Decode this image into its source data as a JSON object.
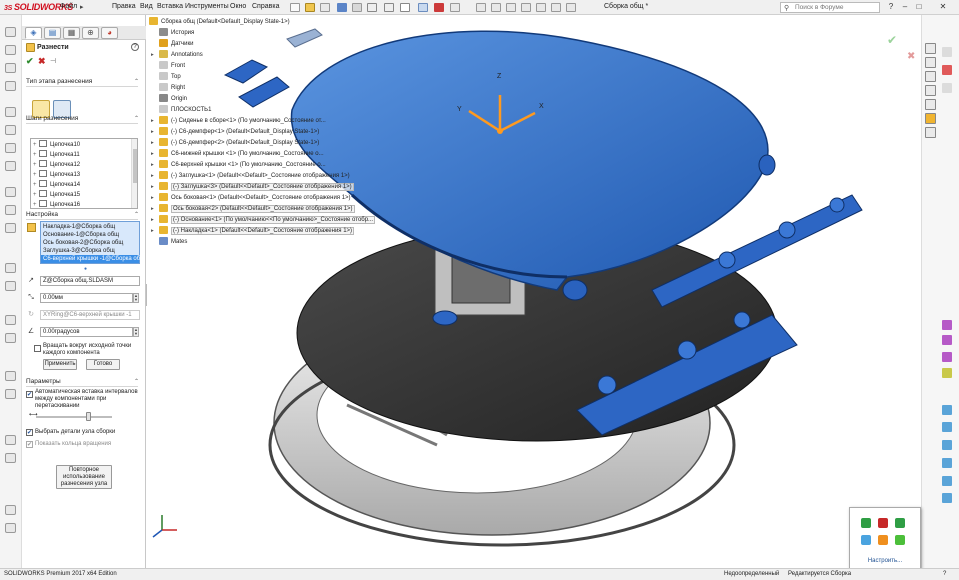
{
  "app": {
    "logo_prefix": "3S",
    "logo": "SOLIDWORKS",
    "document_title": "Сборка общ *"
  },
  "menu": [
    "Файл",
    "Правка",
    "Вид",
    "Вставка",
    "Инструменты",
    "Окно",
    "Справка"
  ],
  "search": {
    "placeholder": "Поиск в Форуме"
  },
  "property_manager": {
    "title": "Разнести",
    "help": "?",
    "ok": "✔",
    "cancel": "✖",
    "pin": "⊣",
    "section_type": "Тип этапа разнесения",
    "section_steps": "Шаги разнесения",
    "steps": [
      {
        "expand": "+",
        "label": "Цепочка10"
      },
      {
        "expand": "+",
        "label": "Цепочка11"
      },
      {
        "expand": "+",
        "label": "Цепочка12"
      },
      {
        "expand": "+",
        "label": "Цепочка13"
      },
      {
        "expand": "+",
        "label": "Цепочка14"
      },
      {
        "expand": "+",
        "label": "Цепочка15"
      },
      {
        "expand": "+",
        "label": "Цепочка16"
      }
    ],
    "section_settings": "Настройка",
    "components": [
      "Накладка-1@Сборка общ",
      "Основание-1@Сборка общ",
      "Ось боковая-2@Сборка общ",
      "Заглушка-3@Сборка общ",
      "С6-верхней крышки -1@Сборка об"
    ],
    "direction_field": "Z@Сборка общ.SLDASM",
    "distance_value": "0.00мм",
    "rotation_axis_placeholder": "XYRing@С6-верхней крышки -1",
    "angle_value": "0.00градусов",
    "rotate_about_origin_label": "Вращать вокруг исходной точки каждого компонента",
    "apply_button": "Применить",
    "done_button": "Готово",
    "section_params": "Параметры",
    "auto_space_label": "Автоматическая вставка интервалов между компонентами при перетаскивании",
    "select_subassembly_label": "Выбрать детали узла сборки",
    "show_rotation_rings_label": "Показать кольца вращения",
    "reuse_button": "Повторное использование разнесения узла",
    "auto_space_checked": true,
    "select_subassembly_checked": true,
    "show_rings_checked": true,
    "rotate_origin_checked": false,
    "spacing_slider_fraction": 0.68
  },
  "tree": {
    "root": "Сборка общ  (Default<Default_Display State-1>)",
    "rows": [
      {
        "expand": "",
        "icon": "history-icon",
        "label": "История",
        "color": "#8c8c8c",
        "boxed": false
      },
      {
        "expand": "",
        "icon": "sensor-icon",
        "label": "Датчики",
        "color": "#e0a01c",
        "boxed": false
      },
      {
        "expand": "▸",
        "icon": "annotations-icon",
        "label": "Annotations",
        "color": "#d9b94a",
        "boxed": false
      },
      {
        "expand": "",
        "icon": "plane-icon",
        "label": "Front",
        "color": "#c9c9c9",
        "boxed": false
      },
      {
        "expand": "",
        "icon": "plane-icon",
        "label": "Top",
        "color": "#c9c9c9",
        "boxed": false
      },
      {
        "expand": "",
        "icon": "plane-icon",
        "label": "Right",
        "color": "#c9c9c9",
        "boxed": false
      },
      {
        "expand": "",
        "icon": "origin-icon",
        "label": "Origin",
        "color": "#888888",
        "boxed": false
      },
      {
        "expand": "",
        "icon": "plane-icon",
        "label": "ПЛОСКОСТЬ1",
        "color": "#c9c9c9",
        "boxed": false
      },
      {
        "expand": "▸",
        "icon": "assembly-icon",
        "label": "(-) Сиденье в сборе<1> (По умолчанию_Состояние от...",
        "color": "#e8b530",
        "boxed": false
      },
      {
        "expand": "▸",
        "icon": "assembly-icon",
        "label": "(-) С6-демпфер<1> (Default<Default_Display State-1>)",
        "color": "#e8b530",
        "boxed": false
      },
      {
        "expand": "▸",
        "icon": "assembly-icon",
        "label": "(-) С6-демпфер<2> (Default<Default_Display State-1>)",
        "color": "#e8b530",
        "boxed": false
      },
      {
        "expand": "▸",
        "icon": "assembly-icon",
        "label": "С6-нижней крышки <1> (По умолчанию_Состояние о...",
        "color": "#e8b530",
        "boxed": false
      },
      {
        "expand": "▸",
        "icon": "assembly-icon",
        "label": "С6-верхней крышки <1> (По умолчанию_Состояние о...",
        "color": "#e8b530",
        "boxed": false
      },
      {
        "expand": "▸",
        "icon": "part-icon",
        "label": "(-) Заглушка<1> (Default<<Default>_Состояние отображения 1>)",
        "color": "#e8b530",
        "boxed": false
      },
      {
        "expand": "▸",
        "icon": "part-icon",
        "label": "(-) Заглушка<3> (Default<<Default>_Состояние отображения 1>)",
        "color": "#e8b530",
        "boxed": true
      },
      {
        "expand": "▸",
        "icon": "part-icon",
        "label": "Ось боковая<1> (Default<<Default>_Состояние отображения 1>)",
        "color": "#e8b530",
        "boxed": false
      },
      {
        "expand": "▸",
        "icon": "part-icon",
        "label": "Ось боковая<2> (Default<<Default>_Состояние отображения 1>)",
        "color": "#e8b530",
        "boxed": true
      },
      {
        "expand": "▸",
        "icon": "part-icon",
        "label": "(-) Основание<1> (По умолчанию<<По умолчанию>_Состояние отобр...",
        "color": "#e8b530",
        "boxed": true
      },
      {
        "expand": "▸",
        "icon": "part-icon",
        "label": "(-) Накладка<1> (Default<<Default>_Состояние отображения 1>)",
        "color": "#e8b530",
        "boxed": true
      },
      {
        "expand": "",
        "icon": "mates-icon",
        "label": "Mates",
        "color": "#6a8cc7",
        "boxed": false
      }
    ]
  },
  "triad": {
    "x": "X",
    "y": "Y",
    "z": "Z"
  },
  "popup": {
    "button": "Настроить..."
  },
  "status": {
    "edition": "SOLIDWORKS Premium 2017 x64 Edition",
    "definition": "Недоопределенный",
    "mode": "Редактируется Сборка",
    "help": "?"
  },
  "colors": {
    "accent": "#3d7ed1",
    "model_blue": "#2f6ec8",
    "model_dark": "#3a3a3a",
    "model_gray": "#d5d5d5"
  }
}
